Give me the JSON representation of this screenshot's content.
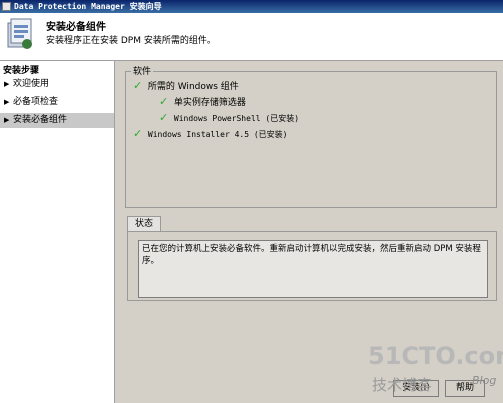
{
  "window": {
    "title": "Data Protection Manager 安装向导"
  },
  "header": {
    "title": "安装必备组件",
    "subtitle": "安装程序正在安装 DPM 安装所需的组件。"
  },
  "sidebar": {
    "heading": "安装步骤",
    "items": [
      {
        "label": "欢迎使用",
        "active": false
      },
      {
        "label": "必备项检查",
        "active": false
      },
      {
        "label": "安装必备组件",
        "active": true
      }
    ]
  },
  "software_group": {
    "label": "软件",
    "items": [
      {
        "label": "所需的 Windows 组件",
        "status": "complete",
        "level": 0
      },
      {
        "label": "单实例存储筛选器",
        "status": "complete",
        "level": 1
      },
      {
        "label": "Windows PowerShell (已安装)",
        "status": "complete",
        "level": 1
      },
      {
        "label": "Windows Installer 4.5 (已安装)",
        "status": "complete",
        "level": 0
      }
    ]
  },
  "tabs": [
    {
      "label": "状态"
    }
  ],
  "status": {
    "text": "已在您的计算机上安装必备软件。重新启动计算机以完成安装，然后重新启动 DPM 安装程序。"
  },
  "buttons": {
    "install": "安装(I)",
    "help": "帮助"
  },
  "watermark": {
    "line1": "51CTO.com",
    "line2": "技术博客",
    "line3": "Blog"
  },
  "colors": {
    "check": "#2fa82f",
    "titlebar": "#0a246a"
  }
}
